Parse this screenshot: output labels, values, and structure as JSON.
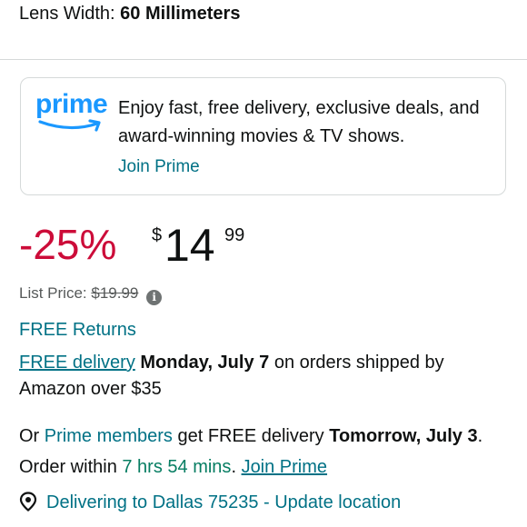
{
  "spec": {
    "label": "Lens Width:",
    "value": "60 Millimeters"
  },
  "prime_banner": {
    "logo_text": "prime",
    "text": "Enjoy fast, free delivery, exclusive deals, and award-winning movies & TV shows.",
    "link": "Join Prime",
    "brand_color": "#1a98ff"
  },
  "price": {
    "discount": "-25%",
    "currency_symbol": "$",
    "whole": "14",
    "fraction": "99",
    "list_price_label": "List Price:",
    "list_price": "$19.99"
  },
  "returns": {
    "label": "FREE Returns"
  },
  "delivery": {
    "link": "FREE delivery",
    "date": "Monday, July 7",
    "text": "on orders shipped by Amazon over $35"
  },
  "fast_delivery": {
    "prefix": "Or",
    "members_link": "Prime members",
    "text1": "get FREE delivery",
    "date": "Tomorrow, July 3",
    "text2": ". Order within",
    "countdown": "7 hrs 54 mins",
    "text3": ".",
    "join_link": "Join Prime"
  },
  "location": {
    "text": "Delivering to Dallas 75235 - Update location"
  },
  "colors": {
    "link": "#007185",
    "discount_red": "#cc0c39",
    "countdown_green": "#067d62",
    "muted": "#565959"
  }
}
